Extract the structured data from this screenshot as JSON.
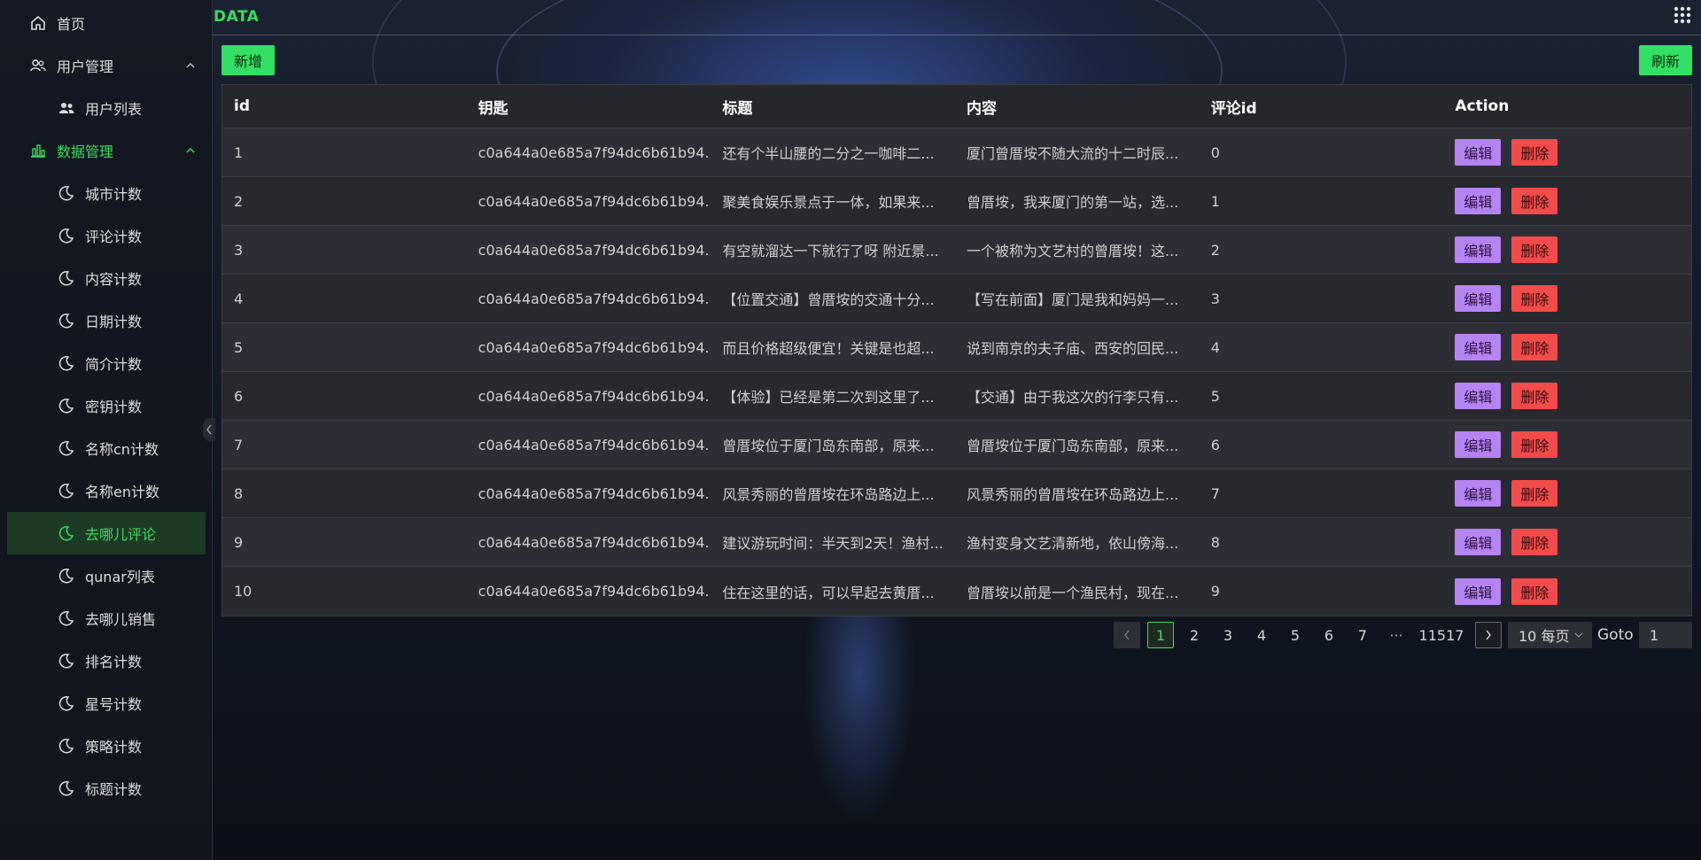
{
  "sidebar": {
    "home": "首页",
    "user_mgmt": "用户管理",
    "user_list": "用户列表",
    "data_mgmt": "数据管理",
    "items": [
      "城市计数",
      "评论计数",
      "内容计数",
      "日期计数",
      "简介计数",
      "密钥计数",
      "名称cn计数",
      "名称en计数",
      "去哪儿评论",
      "qunar列表",
      "去哪儿销售",
      "排名计数",
      "星号计数",
      "策略计数",
      "标题计数"
    ],
    "active_item": "去哪儿评论"
  },
  "header": {
    "brand": "DATA"
  },
  "toolbar": {
    "add_label": "新增",
    "refresh_label": "刷新"
  },
  "table": {
    "columns": [
      "id",
      "钥匙",
      "标题",
      "内容",
      "评论id",
      "Action"
    ],
    "rows": [
      [
        "1",
        "c0a644a0e685a7f94dc6b61b94...",
        "还有个半山腰的二分之一咖啡二...",
        "厦门曾厝垵不随大流的十二时辰...",
        "0"
      ],
      [
        "2",
        "c0a644a0e685a7f94dc6b61b94...",
        "聚美食娱乐景点于一体，如果来...",
        "曾厝垵，我来厦门的第一站，选...",
        "1"
      ],
      [
        "3",
        "c0a644a0e685a7f94dc6b61b94...",
        "有空就溜达一下就行了呀 附近景...",
        "一个被称为文艺村的曾厝垵！这...",
        "2"
      ],
      [
        "4",
        "c0a644a0e685a7f94dc6b61b94...",
        "【位置交通】曾厝垵的交通十分...",
        "【写在前面】厦门是我和妈妈一...",
        "3"
      ],
      [
        "5",
        "c0a644a0e685a7f94dc6b61b94...",
        "而且价格超级便宜！关键是也超...",
        "说到南京的夫子庙、西安的回民...",
        "4"
      ],
      [
        "6",
        "c0a644a0e685a7f94dc6b61b94...",
        "【体验】已经是第二次到这里了...",
        "【交通】由于我这次的行李只有...",
        "5"
      ],
      [
        "7",
        "c0a644a0e685a7f94dc6b61b94...",
        "曾厝垵位于厦门岛东南部，原来...",
        "曾厝垵位于厦门岛东南部，原来...",
        "6"
      ],
      [
        "8",
        "c0a644a0e685a7f94dc6b61b94...",
        "风景秀丽的曾厝垵在环岛路边上...",
        "风景秀丽的曾厝垵在环岛路边上...",
        "7"
      ],
      [
        "9",
        "c0a644a0e685a7f94dc6b61b94...",
        "建议游玩时间：半天到2天！渔村...",
        "渔村变身文艺清新地，依山傍海...",
        "8"
      ],
      [
        "10",
        "c0a644a0e685a7f94dc6b61b94...",
        "住在这里的话，可以早起去黄厝...",
        "曾厝垵以前是一个渔民村，现在...",
        "9"
      ]
    ],
    "edit_label": "编辑",
    "delete_label": "删除"
  },
  "pagination": {
    "pages": [
      "1",
      "2",
      "3",
      "4",
      "5",
      "6",
      "7"
    ],
    "current": "1",
    "ellipsis": "···",
    "last": "11517",
    "page_size": "10 每页",
    "goto_label": "Goto",
    "goto_value": "1"
  },
  "colors": {
    "accent": "#3ddc5c",
    "edit": "#b683f2",
    "delete": "#f14b4b"
  },
  "icons": [
    "home-icon",
    "users-icon",
    "user-list-icon",
    "chart-icon",
    "moon-icon",
    "chevron-up-icon",
    "apps-grid-icon"
  ]
}
